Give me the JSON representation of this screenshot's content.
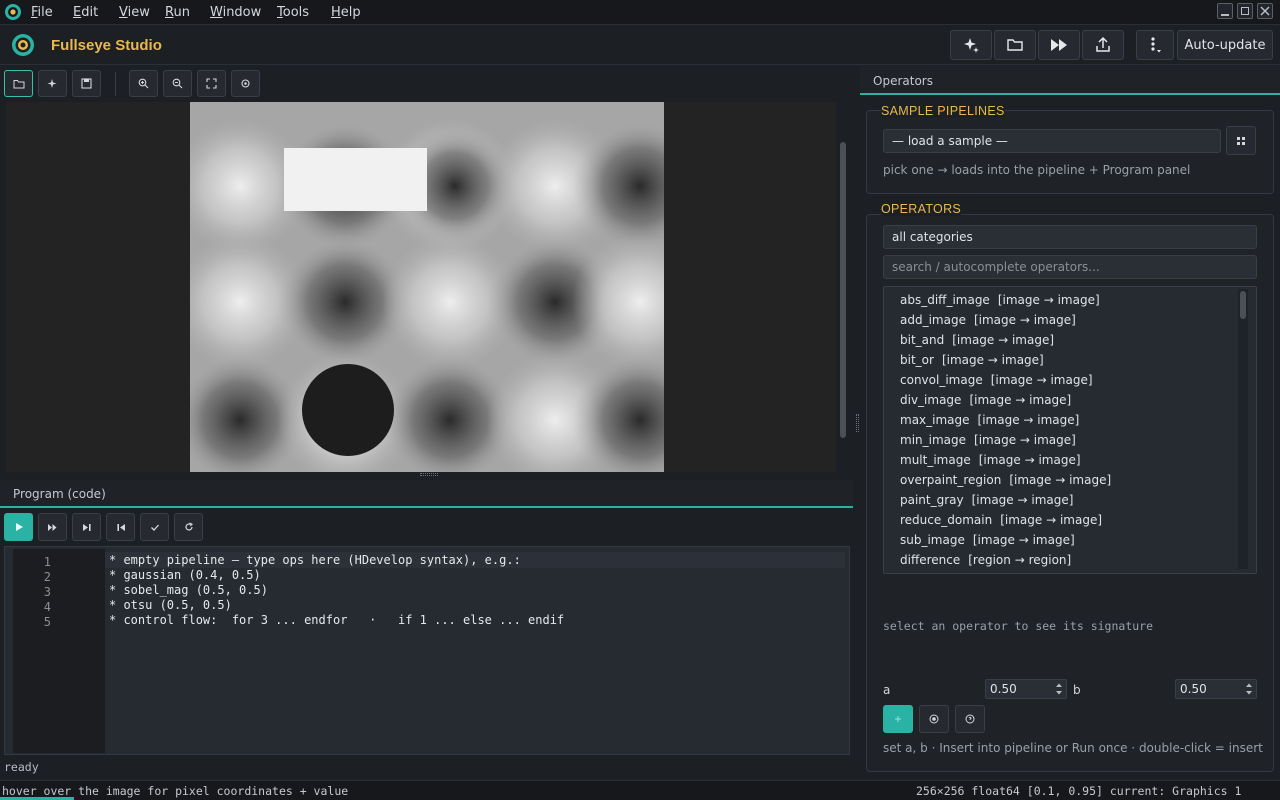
{
  "menubar": {
    "items": [
      {
        "label": "File",
        "accel": "F",
        "rest": "ile"
      },
      {
        "label": "Edit",
        "accel": "E",
        "rest": "dit"
      },
      {
        "label": "View",
        "accel": "V",
        "rest": "iew"
      },
      {
        "label": "Run",
        "accel": "R",
        "rest": "un"
      },
      {
        "label": "Window",
        "accel": "W",
        "rest": "indow"
      },
      {
        "label": "Tools",
        "accel": "T",
        "rest": "ools"
      },
      {
        "label": "Help",
        "accel": "H",
        "rest": "elp"
      }
    ]
  },
  "header": {
    "title": "Fullseye Studio",
    "toolbar_icons": [
      "sparkle-icon",
      "folder-icon",
      "fast-forward-icon",
      "share-icon",
      "kebab-menu-icon"
    ],
    "auto_update_label": "Auto-update"
  },
  "viewer": {
    "toolbar_icons": [
      "folder-icon",
      "sparkle-icon",
      "save-icon",
      "zoom-in-icon",
      "zoom-out-icon",
      "fit-icon",
      "reset-icon"
    ]
  },
  "program": {
    "tab_label": "Program (code)",
    "controls": [
      "run-icon",
      "step-icon",
      "skip-icon",
      "rewind-icon",
      "check-icon",
      "refresh-icon"
    ],
    "lines": [
      {
        "num": "1",
        "text": "* empty pipeline — type ops here (HDevelop syntax), e.g.:"
      },
      {
        "num": "2",
        "text": "* gaussian (0.4, 0.5)"
      },
      {
        "num": "3",
        "text": "* sobel_mag (0.5, 0.5)"
      },
      {
        "num": "4",
        "text": "* otsu (0.5, 0.5)"
      },
      {
        "num": "5",
        "text": "* control flow:  for 3 ... endfor   ·   if 1 ... else ... endif"
      }
    ]
  },
  "operators_panel": {
    "tab_label": "Operators",
    "samples": {
      "title": "SAMPLE PIPELINES",
      "select_value": "— load a sample —",
      "hint": "pick one → loads into the pipeline + Program panel"
    },
    "operators": {
      "title": "OPERATORS",
      "category_value": "all categories",
      "search_placeholder": "search / autocomplete operators...",
      "items": [
        {
          "name": "abs_diff_image",
          "sig": "[image → image]"
        },
        {
          "name": "add_image",
          "sig": "[image → image]"
        },
        {
          "name": "bit_and",
          "sig": "[image → image]"
        },
        {
          "name": "bit_or",
          "sig": "[image → image]"
        },
        {
          "name": "convol_image",
          "sig": "[image → image]"
        },
        {
          "name": "div_image",
          "sig": "[image → image]"
        },
        {
          "name": "max_image",
          "sig": "[image → image]"
        },
        {
          "name": "min_image",
          "sig": "[image → image]"
        },
        {
          "name": "mult_image",
          "sig": "[image → image]"
        },
        {
          "name": "overpaint_region",
          "sig": "[image → image]"
        },
        {
          "name": "paint_gray",
          "sig": "[image → image]"
        },
        {
          "name": "reduce_domain",
          "sig": "[image → image]"
        },
        {
          "name": "sub_image",
          "sig": "[image → image]"
        },
        {
          "name": "difference",
          "sig": "[region → region]"
        }
      ],
      "signature_hint": "select an operator to see its signature",
      "param_a_label": "a",
      "param_a_value": "0.50",
      "param_b_label": "b",
      "param_b_value": "0.50",
      "footer_hint": "set a, b · Insert into pipeline or Run once · double-click = insert"
    }
  },
  "status": {
    "state": "ready",
    "hover_hint": "hover over the image for pixel coordinates + value",
    "image_info": "256×256 float64 [0.1, 0.95] current: Graphics 1"
  },
  "colors": {
    "accent": "#2ab3a5",
    "brand": "#e8b94d"
  }
}
